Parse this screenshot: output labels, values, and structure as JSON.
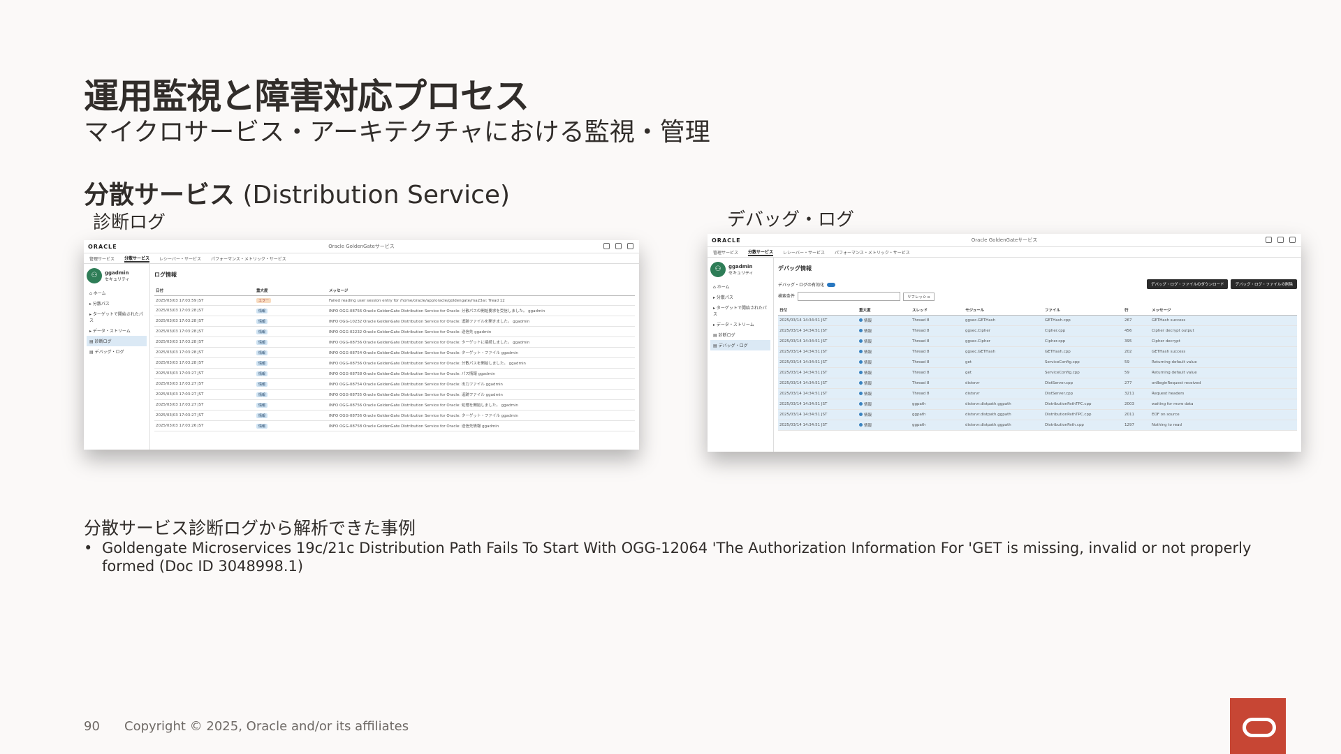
{
  "slide": {
    "title": "運用監視と障害対応プロセス",
    "subtitle": "マイクロサービス・アーキテクチャにおける監視・管理",
    "section_bold": "分散サービス",
    "section_rest": " (Distribution Service)",
    "caption_left": "診断ログ",
    "caption_right": "デバッグ・ログ",
    "examples_heading": "分散サービス診断ログから解析できた事例",
    "bullet_mark": "•",
    "bullet_text": "Goldengate Microservices 19c/21c Distribution Path Fails To Start With OGG-12064 'The Authorization Information For 'GET is missing, invalid or not properly formed (Doc ID 3048998.1)",
    "page_number": "90",
    "copyright": "Copyright © 2025, Oracle and/or its affiliates",
    "brand_icon": "oracle-logo-icon",
    "brand_color": "#c74634"
  },
  "screen_common": {
    "logo": "ORACLE",
    "app_title": "Oracle GoldenGateサービス",
    "nav": [
      "管理サービス",
      "分散サービス",
      "レシーバー・サービス",
      "パフォーマンス・メトリック・サービス"
    ],
    "user_name": "ggadmin",
    "user_role": "セキュリティ",
    "side_items": [
      "ホーム",
      "分散パス",
      "ターゲットで開始されたパス",
      "データ・ストリーム",
      "診断ログ",
      "デバッグ・ログ"
    ]
  },
  "diag": {
    "header": "ログ情報",
    "columns": [
      "日付",
      "重大度",
      "メッセージ"
    ],
    "rows": [
      {
        "date": "2025/03/03 17:03:59 JST",
        "sev": "エラー",
        "warn": true,
        "msg": "Failed reading user session entry for /home/oracle/app/oracle/goldengate/ma23ai: Tread 12"
      },
      {
        "date": "2025/03/03 17:03:28 JST",
        "sev": "情報",
        "warn": false,
        "msg": "INFO OGG-08756 Oracle GoldenGate Distribution Service for Oracle: 分散パスの開始要求を受信しました。 ggadmin"
      },
      {
        "date": "2025/03/03 17:03:28 JST",
        "sev": "情報",
        "warn": false,
        "msg": "INFO OGG-10232 Oracle GoldenGate Distribution Service for Oracle: 追跡ファイルを開きました。 ggadmin"
      },
      {
        "date": "2025/03/03 17:03:28 JST",
        "sev": "情報",
        "warn": false,
        "msg": "INFO OGG-02232 Oracle GoldenGate Distribution Service for Oracle: 送信先 ggadmin"
      },
      {
        "date": "2025/03/03 17:03:28 JST",
        "sev": "情報",
        "warn": false,
        "msg": "INFO OGG-08756 Oracle GoldenGate Distribution Service for Oracle: ターゲットに接続しました。 ggadmin"
      },
      {
        "date": "2025/03/03 17:03:28 JST",
        "sev": "情報",
        "warn": false,
        "msg": "INFO OGG-08754 Oracle GoldenGate Distribution Service for Oracle: ターゲット・ファイル ggadmin"
      },
      {
        "date": "2025/03/03 17:03:28 JST",
        "sev": "情報",
        "warn": false,
        "msg": "INFO OGG-08756 Oracle GoldenGate Distribution Service for Oracle: 分散パスを開始しました。 ggadmin"
      },
      {
        "date": "2025/03/03 17:03:27 JST",
        "sev": "情報",
        "warn": false,
        "msg": "INFO OGG-08758 Oracle GoldenGate Distribution Service for Oracle: パス情報 ggadmin"
      },
      {
        "date": "2025/03/03 17:03:27 JST",
        "sev": "情報",
        "warn": false,
        "msg": "INFO OGG-08754 Oracle GoldenGate Distribution Service for Oracle: 出力ファイル ggadmin"
      },
      {
        "date": "2025/03/03 17:03:27 JST",
        "sev": "情報",
        "warn": false,
        "msg": "INFO OGG-08755 Oracle GoldenGate Distribution Service for Oracle: 追跡ファイル ggadmin"
      },
      {
        "date": "2025/03/03 17:03:27 JST",
        "sev": "情報",
        "warn": false,
        "msg": "INFO OGG-08756 Oracle GoldenGate Distribution Service for Oracle: 処理を開始しました。 ggadmin"
      },
      {
        "date": "2025/03/03 17:03:27 JST",
        "sev": "情報",
        "warn": false,
        "msg": "INFO OGG-08756 Oracle GoldenGate Distribution Service for Oracle: ターゲット・ファイル ggadmin"
      },
      {
        "date": "2025/03/03 17:03:26 JST",
        "sev": "情報",
        "warn": false,
        "msg": "INFO OGG-08758 Oracle GoldenGate Distribution Service for Oracle: 送信先情報 ggadmin"
      }
    ]
  },
  "debug": {
    "header": "デバッグ情報",
    "toggle_label": "デバッグ・ログの有効化",
    "search_label": "検索条件",
    "refresh_label": "リフレッシュ",
    "btn_download": "デバッグ・ログ・ファイルのダウンロード",
    "btn_delete": "デバッグ・ログ・ファイルの削除",
    "columns": [
      "日付",
      "重大度",
      "スレッド",
      "モジュール",
      "ファイル",
      "行",
      "メッセージ"
    ],
    "rows": [
      {
        "date": "2025/03/14 14:34:51 JST",
        "sev": "情報",
        "thread": "Thread 8",
        "module": "ggsec.GETHash",
        "file": "GETHash.cpp",
        "line": "267",
        "msg": "GETHash success"
      },
      {
        "date": "2025/03/14 14:34:51 JST",
        "sev": "情報",
        "thread": "Thread 8",
        "module": "ggsec.Cipher",
        "file": "Cipher.cpp",
        "line": "456",
        "msg": "Cipher decrypt output"
      },
      {
        "date": "2025/03/14 14:34:51 JST",
        "sev": "情報",
        "thread": "Thread 8",
        "module": "ggsec.Cipher",
        "file": "Cipher.cpp",
        "line": "395",
        "msg": "Cipher decrypt"
      },
      {
        "date": "2025/03/14 14:34:51 JST",
        "sev": "情報",
        "thread": "Thread 8",
        "module": "ggsec.GETHash",
        "file": "GETHash.cpp",
        "line": "202",
        "msg": "GETHash success"
      },
      {
        "date": "2025/03/14 14:34:51 JST",
        "sev": "情報",
        "thread": "Thread 8",
        "module": "get",
        "file": "ServiceConfig.cpp",
        "line": "59",
        "msg": "Returning default value"
      },
      {
        "date": "2025/03/14 14:34:51 JST",
        "sev": "情報",
        "thread": "Thread 8",
        "module": "get",
        "file": "ServiceConfig.cpp",
        "line": "59",
        "msg": "Returning default value"
      },
      {
        "date": "2025/03/14 14:34:51 JST",
        "sev": "情報",
        "thread": "Thread 8",
        "module": "distsrvr",
        "file": "DistServer.cpp",
        "line": "277",
        "msg": "onBeginRequest received"
      },
      {
        "date": "2025/03/14 14:34:51 JST",
        "sev": "情報",
        "thread": "Thread 8",
        "module": "distsrvr",
        "file": "DistServer.cpp",
        "line": "3211",
        "msg": "Request headers"
      },
      {
        "date": "2025/03/14 14:34:51 JST",
        "sev": "情報",
        "thread": "ggpath",
        "module": "distsrvr.distpath.ggpath",
        "file": "DistributionPathTPC.cpp",
        "line": "2003",
        "msg": "waiting for more data"
      },
      {
        "date": "2025/03/14 14:34:51 JST",
        "sev": "情報",
        "thread": "ggpath",
        "module": "distsrvr.distpath.ggpath",
        "file": "DistributionPathTPC.cpp",
        "line": "2011",
        "msg": "EOF on source"
      },
      {
        "date": "2025/03/14 14:34:51 JST",
        "sev": "情報",
        "thread": "ggpath",
        "module": "distsrvr.distpath.ggpath",
        "file": "DistributionPath.cpp",
        "line": "1297",
        "msg": "Nothing to read"
      }
    ]
  }
}
